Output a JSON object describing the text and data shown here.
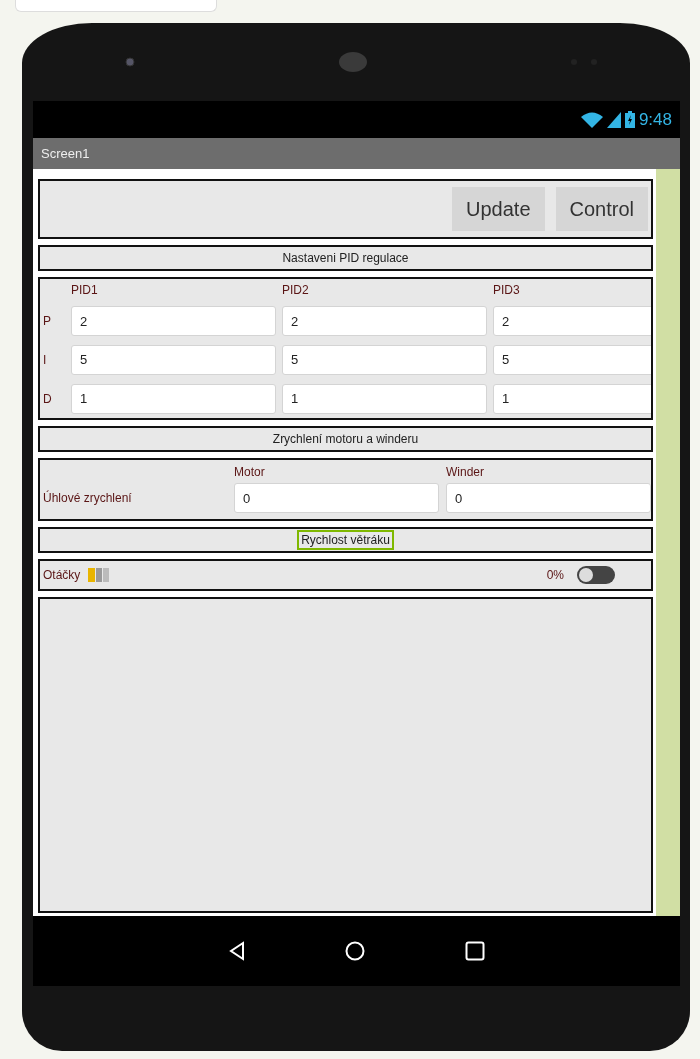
{
  "status_bar": {
    "time": "9:48"
  },
  "title_bar": {
    "title": "Screen1"
  },
  "buttons": [
    {
      "label": "Update"
    },
    {
      "label": "Control"
    }
  ],
  "pid_section": {
    "heading": "Nastaveni PID regulace",
    "columns": [
      "PID1",
      "PID2",
      "PID3"
    ],
    "rows": [
      {
        "label": "P",
        "values": [
          "2",
          "2",
          "2"
        ]
      },
      {
        "label": "I",
        "values": [
          "5",
          "5",
          "5"
        ]
      },
      {
        "label": "D",
        "values": [
          "1",
          "1",
          "1"
        ]
      }
    ]
  },
  "accel_section": {
    "heading": "Zrychlení motoru a winderu",
    "columns": [
      "Motor",
      "Winder"
    ],
    "row_label": "Úhlové zrychlení",
    "values": [
      "0",
      "0"
    ]
  },
  "fan_section": {
    "heading": "Rychlost větráku",
    "selected": true,
    "label": "Otáčky",
    "reading": "0%",
    "switch_on": false
  }
}
